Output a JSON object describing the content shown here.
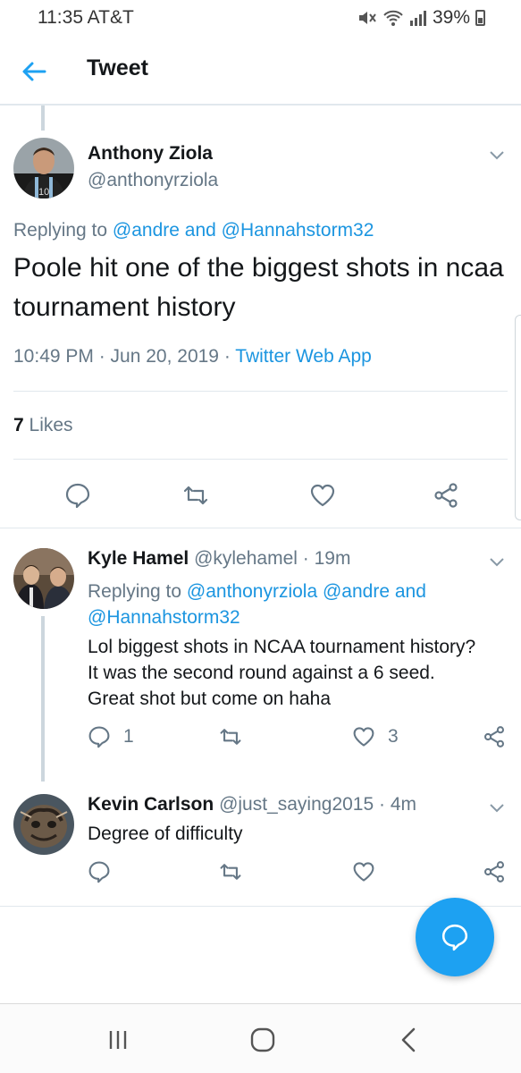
{
  "status_bar": {
    "time": "11:35 AT&T",
    "battery": "39%"
  },
  "header": {
    "title": "Tweet"
  },
  "main_tweet": {
    "author_name": "Anthony Ziola",
    "author_handle": "@anthonyrziola",
    "replying_prefix": "Replying to",
    "mention_1": "@andre",
    "and_word": "and",
    "mention_2": "@Hannahstorm32",
    "text": "Poole hit one of the biggest shots in ncaa tournament history",
    "timestamp": "10:49 PM · Jun 20, 2019 ·",
    "source_app": "Twitter Web App",
    "likes_count": "7",
    "likes_label": "Likes"
  },
  "replies": [
    {
      "name": "Kyle Hamel",
      "handle": "@kylehamel",
      "dot": "·",
      "time": "19m",
      "replying_prefix": "Replying to",
      "mention_1": "@anthonyrziola",
      "mention_2": "@andre",
      "and_word": "and",
      "mention_3": "@Hannahstorm32",
      "text_line_1": "Lol biggest shots in NCAA tournament history?",
      "text_line_2": "It was the second round against a 6 seed.",
      "text_line_3": "Great shot but come on haha",
      "reply_count": "1",
      "like_count": "3"
    },
    {
      "name": "Kevin Carlson",
      "handle": "@just_saying2015",
      "dot": "·",
      "time": "4m",
      "text": "Degree of difficulty"
    }
  ],
  "colors": {
    "accent": "#1da1f2",
    "link": "#1b95e0",
    "secondary_text": "#657786",
    "divider": "#e1e8ed"
  },
  "icons": [
    "back-arrow-icon",
    "chevron-down-icon",
    "reply-icon",
    "retweet-icon",
    "like-icon",
    "share-icon",
    "compose-reply-icon",
    "recent-apps-icon",
    "home-icon",
    "back-icon"
  ]
}
